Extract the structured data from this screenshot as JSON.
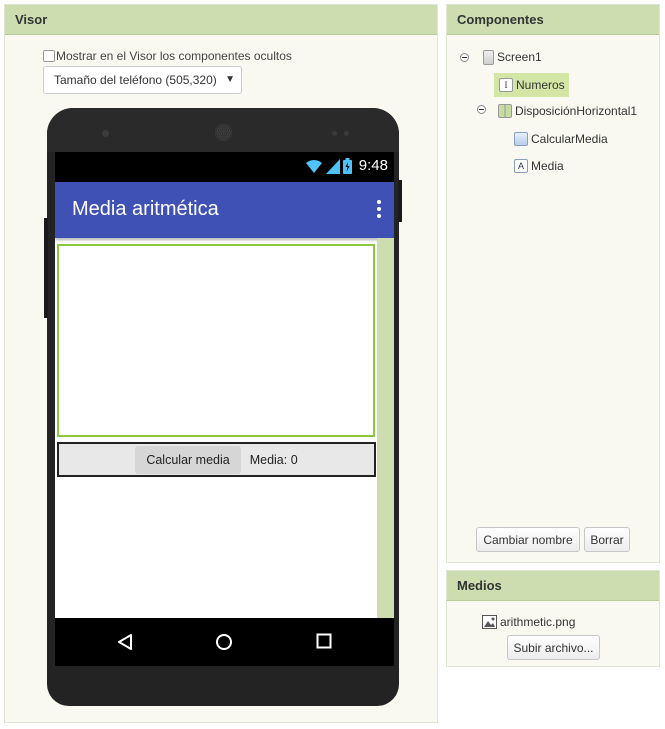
{
  "visor": {
    "title": "Visor",
    "show_hidden_label": "Mostrar en el Visor los componentes ocultos",
    "size_select_value": "Tamaño del teléfono (505,320)"
  },
  "phone": {
    "status_time": "9:48",
    "app_title": "Media aritmética",
    "calc_button_label": "Calcular media",
    "media_label": "Media: 0"
  },
  "componentes": {
    "title": "Componentes",
    "tree": [
      {
        "label": "Screen1"
      },
      {
        "label": "Numeros"
      },
      {
        "label": "DisposiciónHorizontal1"
      },
      {
        "label": "CalcularMedia"
      },
      {
        "label": "Media"
      }
    ],
    "rename_label": "Cambiar nombre",
    "delete_label": "Borrar"
  },
  "medios": {
    "title": "Medios",
    "file_name": "arithmetic.png",
    "upload_label": "Subir archivo..."
  },
  "colors": {
    "panel_header": "#cdddb0",
    "app_bar": "#3f51b5",
    "selection": "#d4e6a5",
    "textbox_border": "#8dc63f"
  }
}
